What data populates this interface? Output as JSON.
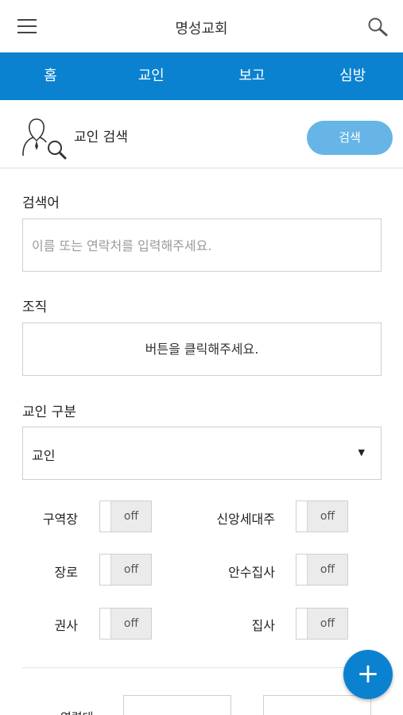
{
  "header": {
    "title": "명성교회"
  },
  "tabs": [
    {
      "label": "홈",
      "active": false
    },
    {
      "label": "교인",
      "active": true
    },
    {
      "label": "보고",
      "active": false
    },
    {
      "label": "심방",
      "active": false
    }
  ],
  "section": {
    "title": "교인 검색",
    "search_button": "검색"
  },
  "form": {
    "keyword": {
      "label": "검색어",
      "placeholder": "이름 또는 연락처를 입력해주세요."
    },
    "org": {
      "label": "조직",
      "button_text": "버튼을 클릭해주세요."
    },
    "member_type": {
      "label": "교인 구분",
      "selected": "교인"
    }
  },
  "toggles": [
    {
      "label": "구역장",
      "state": "off"
    },
    {
      "label": "신앙세대주",
      "state": "off"
    },
    {
      "label": "장로",
      "state": "off"
    },
    {
      "label": "안수집사",
      "state": "off"
    },
    {
      "label": "권사",
      "state": "off"
    },
    {
      "label": "집사",
      "state": "off"
    }
  ],
  "bottom": {
    "label": "연령대",
    "fab": "+"
  },
  "colors": {
    "primary": "#0b82d0",
    "search_button": "#66b5e6",
    "toggle_off_bg": "#ebebeb"
  }
}
